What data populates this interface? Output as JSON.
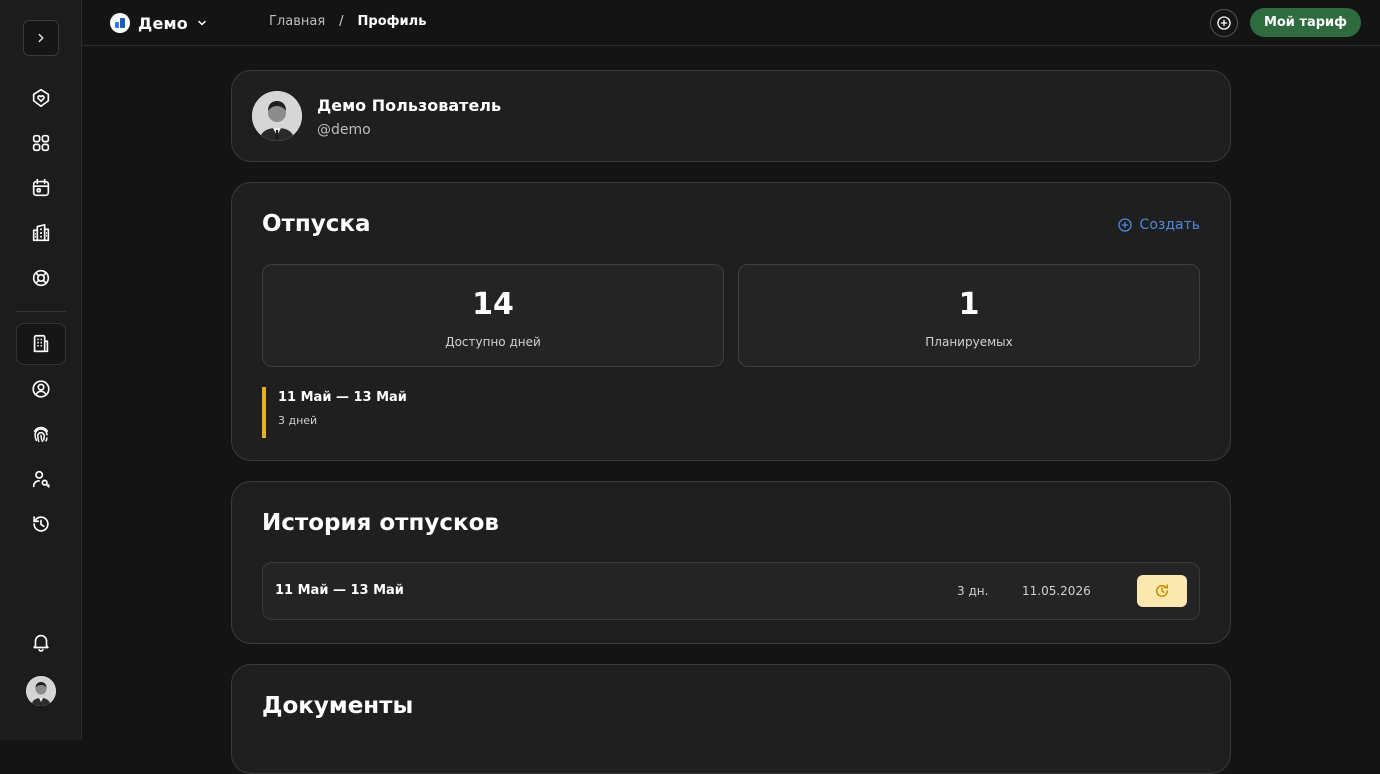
{
  "header": {
    "org_name": "Демо",
    "breadcrumb": {
      "home": "Главная",
      "separator": "/",
      "current": "Профиль"
    },
    "plan_button": "Мой тариф"
  },
  "sidebar": {
    "items": [
      {
        "icon": "home-shield-icon"
      },
      {
        "icon": "apps-grid-icon"
      },
      {
        "icon": "calendar-icon"
      },
      {
        "icon": "buildings-icon"
      },
      {
        "icon": "lifebuoy-icon"
      },
      {
        "icon": "building-icon",
        "active": true
      },
      {
        "icon": "user-circle-icon"
      },
      {
        "icon": "fingerprint-icon"
      },
      {
        "icon": "user-key-icon"
      },
      {
        "icon": "history-icon"
      }
    ],
    "bottom": [
      {
        "icon": "bell-icon"
      },
      {
        "icon": "avatar"
      }
    ]
  },
  "profile": {
    "name": "Демо Пользователь",
    "login": "@demo"
  },
  "vacations": {
    "title": "Отпуска",
    "create_label": "Создать",
    "available_value": "14",
    "available_label": "Доступно дней",
    "planned_value": "1",
    "planned_label": "Планируемых",
    "planned_item": {
      "range": "11 Май — 13 Май",
      "days": "3 дней"
    }
  },
  "history": {
    "title": "История отпусков",
    "rows": [
      {
        "range": "11 Май — 13 Май",
        "days": "3 дн.",
        "date": "11.05.2026",
        "status_icon": "pending-clock-icon"
      }
    ]
  },
  "documents": {
    "title": "Документы"
  },
  "colors": {
    "background": "#141414",
    "card": "#1f1f1f",
    "accent_green": "#2e6b3e",
    "link_blue": "#4a8ad9",
    "planned_bar": "#e6b020",
    "status_bg": "#fbe7b0"
  }
}
